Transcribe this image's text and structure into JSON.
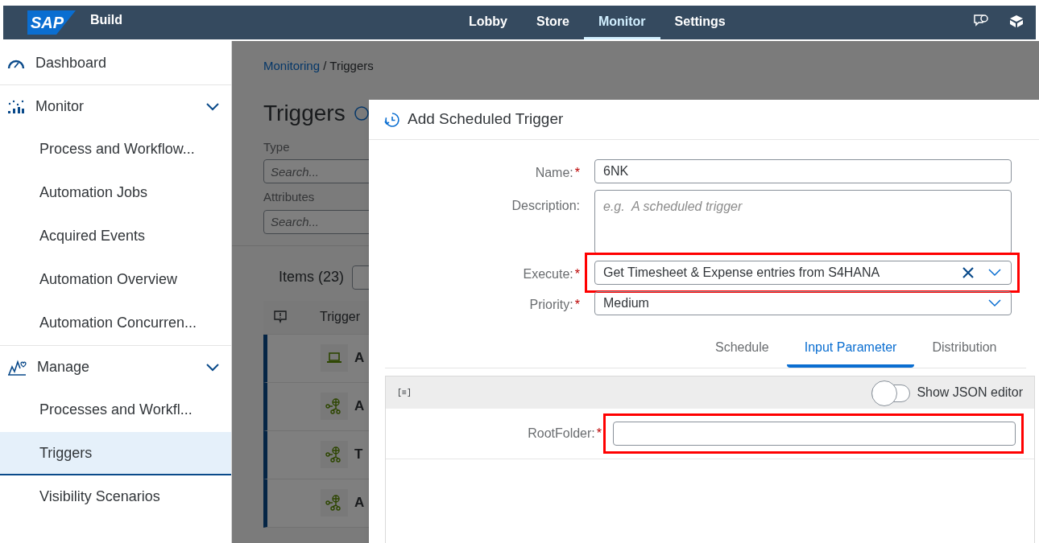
{
  "shell_bar": {
    "logo": "SAP",
    "product": "Build",
    "nav": [
      {
        "label": "Lobby",
        "selected": false
      },
      {
        "label": "Store",
        "selected": false
      },
      {
        "label": "Monitor",
        "selected": true
      },
      {
        "label": "Settings",
        "selected": false
      }
    ]
  },
  "sidebar": {
    "items": [
      {
        "label": "Dashboard",
        "kind": "gauge",
        "selected": false
      },
      {
        "label": "Monitor",
        "kind": "chart",
        "expanded": true,
        "selected": false,
        "children": [
          {
            "label": "Process and Workflow...",
            "selected": false
          },
          {
            "label": "Automation Jobs",
            "selected": false
          },
          {
            "label": "Acquired Events",
            "selected": false
          },
          {
            "label": "Automation Overview",
            "selected": false
          },
          {
            "label": "Automation Concurren...",
            "selected": false
          }
        ]
      },
      {
        "label": "Manage",
        "kind": "heart",
        "expanded": true,
        "selected": false,
        "children": [
          {
            "label": "Processes and Workfl...",
            "selected": false
          },
          {
            "label": "Triggers",
            "selected": true
          },
          {
            "label": "Visibility Scenarios",
            "selected": false
          }
        ]
      }
    ]
  },
  "page": {
    "breadcrumb": {
      "link": "Monitoring",
      "current": "/ Triggers"
    },
    "title": "Triggers",
    "filters": [
      {
        "label": "Type",
        "placeholder": "Search..."
      },
      {
        "label": "Attributes",
        "placeholder": "Search..."
      }
    ],
    "items_count": "Items (23)",
    "table": {
      "columns": [
        "Trigger"
      ],
      "rows": [
        {
          "kind": "laptop",
          "text": "A"
        },
        {
          "kind": "network",
          "text": "A"
        },
        {
          "kind": "network",
          "text": "T"
        },
        {
          "kind": "network",
          "text": "A"
        }
      ]
    }
  },
  "dialog": {
    "title": "Add Scheduled Trigger",
    "fields": [
      {
        "kind": "input",
        "label": "Name:",
        "required_mark": "*",
        "value": "6NK",
        "highlighted": false
      },
      {
        "kind": "textarea",
        "label": "Description:",
        "placeholder": "e.g.  A scheduled trigger",
        "highlighted": false
      },
      {
        "kind": "combo",
        "label": "Execute:",
        "required_mark": "*",
        "value": "Get Timesheet & Expense entries from S4HANA",
        "clearable": true,
        "highlighted": true
      },
      {
        "kind": "select",
        "label": "Priority:",
        "required_mark": "*",
        "value": "Medium",
        "clearable": false,
        "highlighted": false
      }
    ],
    "tabs": [
      {
        "label": "Schedule",
        "selected": false
      },
      {
        "label": "Input Parameter",
        "selected": true
      },
      {
        "label": "Distribution",
        "selected": false
      }
    ],
    "panel": {
      "icon_text": "[≡]",
      "toggle": {
        "label": "Show JSON editor",
        "on": false
      },
      "params": [
        {
          "label": "RootFolder:",
          "required_mark": "*",
          "highlighted": true
        }
      ]
    }
  }
}
